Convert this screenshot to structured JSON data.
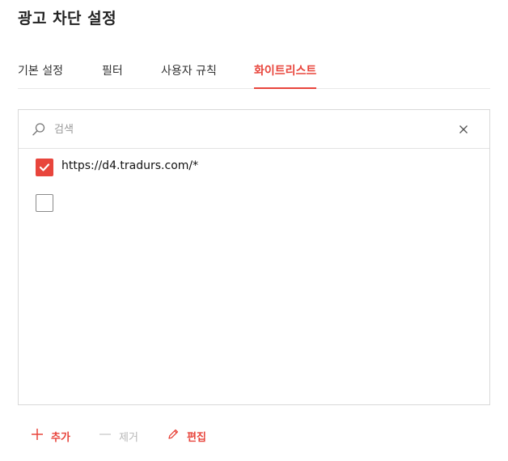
{
  "page": {
    "title": "광고 차단 설정"
  },
  "tabs": [
    {
      "label": "기본 설정",
      "active": false
    },
    {
      "label": "필터",
      "active": false
    },
    {
      "label": "사용자 규칙",
      "active": false
    },
    {
      "label": "화이트리스트",
      "active": true
    }
  ],
  "search": {
    "placeholder": "검색",
    "value": ""
  },
  "whitelist": {
    "items": [
      {
        "label": "https://d4.tradurs.com/*",
        "checked": true
      },
      {
        "label": "",
        "checked": false
      }
    ]
  },
  "actions": {
    "add_label": "추가",
    "remove_label": "제거",
    "edit_label": "편집"
  },
  "colors": {
    "accent": "#e8453c",
    "disabled": "#b7b7b7",
    "border": "#d9d9d9"
  },
  "icons": {
    "search": "search-icon",
    "clear": "close-icon",
    "add": "plus-icon",
    "remove": "minus-icon",
    "edit": "pencil-icon",
    "check": "check-icon"
  }
}
